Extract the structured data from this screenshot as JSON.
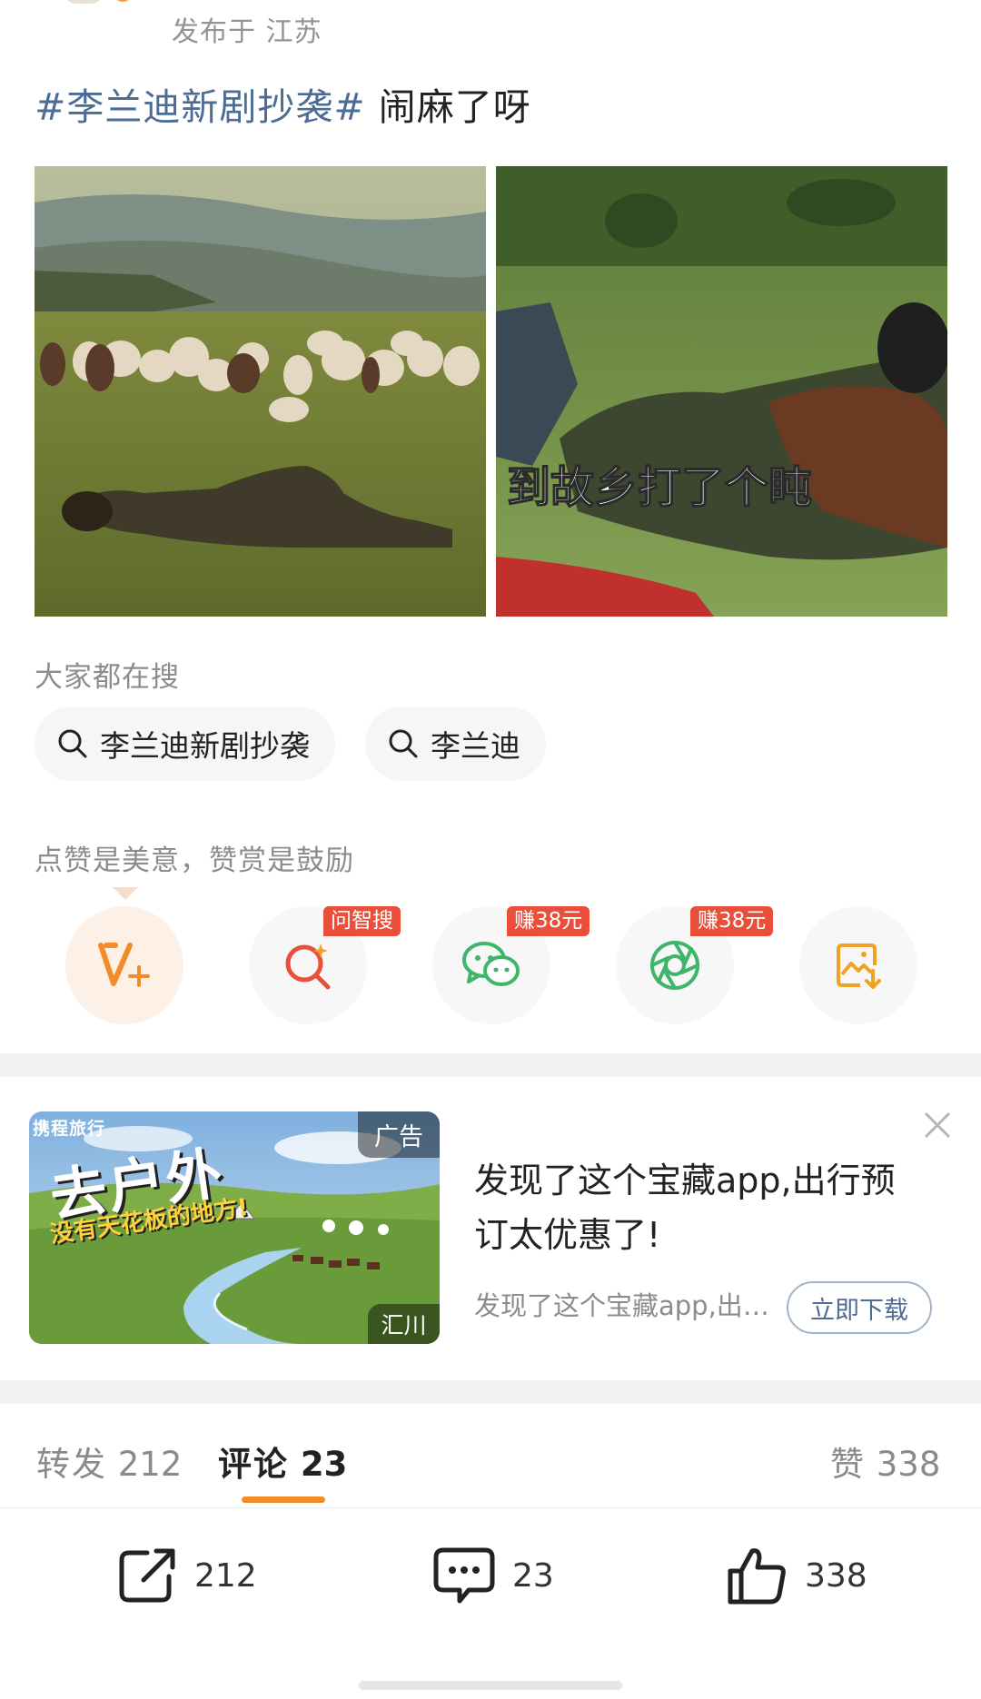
{
  "post": {
    "location": "发布于 江苏",
    "hashtag": "#李兰迪新剧抄袭#",
    "text": " 闹麻了呀",
    "image_right_caption": "到故乡打了个盹"
  },
  "trending": {
    "label": "大家都在搜",
    "chips": [
      "李兰迪新剧抄袭",
      "李兰迪"
    ]
  },
  "reward": {
    "label": "点赞是美意，赞赏是鼓励",
    "badges": {
      "search": "问智搜",
      "wechat": "赚38元",
      "moments": "赚38元"
    }
  },
  "ad": {
    "brand": "携程旅行",
    "headline": "去户外",
    "subhead": "没有天花板的地方!",
    "tag": "广告",
    "source": "汇川",
    "title": "发现了这个宝藏app,出行预订太优惠了!",
    "description": "发现了这个宝藏app,出行预订太优惠了!",
    "cta": "立即下载"
  },
  "tabs": {
    "repost_label": "转发",
    "repost_count": "212",
    "comment_label": "评论",
    "comment_count": "23",
    "like_label": "赞",
    "like_count": "338"
  },
  "bottom_bar": {
    "repost": "212",
    "comment": "23",
    "like": "338"
  },
  "colors": {
    "hashtag": "#4c6b95",
    "accent": "#f28c28",
    "badge": "#e94f3a",
    "wechat": "#3fb56a"
  }
}
